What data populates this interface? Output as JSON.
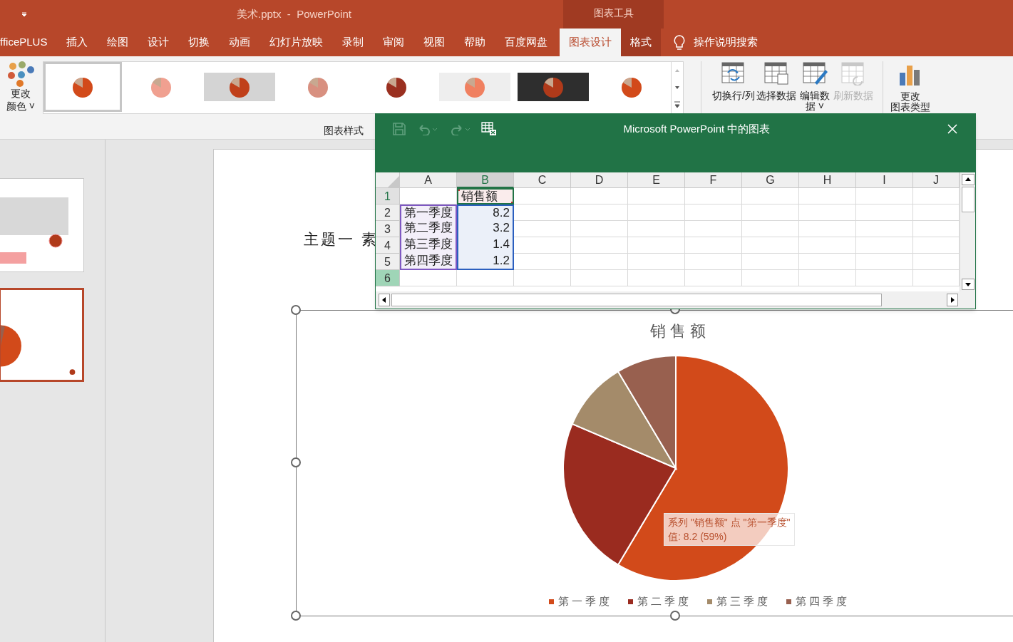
{
  "title_bar": {
    "title": "美术.pptx  -  PowerPoint",
    "context_group": "图表工具"
  },
  "tabs": [
    {
      "label": "fficePLUS",
      "selected": false,
      "context": false
    },
    {
      "label": "插入",
      "selected": false,
      "context": false
    },
    {
      "label": "绘图",
      "selected": false,
      "context": false
    },
    {
      "label": "设计",
      "selected": false,
      "context": false
    },
    {
      "label": "切换",
      "selected": false,
      "context": false
    },
    {
      "label": "动画",
      "selected": false,
      "context": false
    },
    {
      "label": "幻灯片放映",
      "selected": false,
      "context": false
    },
    {
      "label": "录制",
      "selected": false,
      "context": false
    },
    {
      "label": "审阅",
      "selected": false,
      "context": false
    },
    {
      "label": "视图",
      "selected": false,
      "context": false
    },
    {
      "label": "帮助",
      "selected": false,
      "context": false
    },
    {
      "label": "百度网盘",
      "selected": false,
      "context": false
    },
    {
      "label": "图表设计",
      "selected": true,
      "context": true
    },
    {
      "label": "格式",
      "selected": false,
      "context": true
    }
  ],
  "tell_me": "操作说明搜索",
  "ribbon": {
    "change_colors": {
      "line1": "更改",
      "line2": "颜色",
      "caret": "˅"
    },
    "gallery": {
      "label": "图表样式",
      "styles": [
        {
          "selected": true,
          "kind": "plain"
        },
        {
          "selected": false,
          "kind": "striped"
        },
        {
          "selected": false,
          "kind": "gray"
        },
        {
          "selected": false,
          "kind": "pale"
        },
        {
          "selected": false,
          "kind": "textured"
        },
        {
          "selected": false,
          "kind": "hatched"
        },
        {
          "selected": false,
          "kind": "dark"
        },
        {
          "selected": false,
          "kind": "plain"
        }
      ]
    },
    "data_buttons": [
      {
        "label": "切换行/列",
        "disabled": false
      },
      {
        "label": "选择数据",
        "disabled": false
      },
      {
        "label": "编辑数据",
        "disabled": false,
        "caret": "˅"
      },
      {
        "label": "刷新数据",
        "disabled": true
      }
    ],
    "chart_type_button": {
      "line1": "更改",
      "line2": "图表类型"
    }
  },
  "slides": [
    {
      "selected": false
    },
    {
      "selected": true
    }
  ],
  "slide": {
    "title": "主题一 素",
    "chart": {
      "tooltip": {
        "line1": "系列 \"销售额\" 点 \"第一季度\"",
        "line2": "值: 8.2 (59%)"
      },
      "chart_data": {
        "type": "pie",
        "title": "销售额",
        "legend": "bottom",
        "categories": [
          "第一季度",
          "第二季度",
          "第三季度",
          "第四季度"
        ],
        "series": [
          {
            "colors": [
              "#d24a1a",
              "#9a2b1f",
              "#a48b6a",
              "#98604f"
            ],
            "values": [
              58.57,
              22.86,
              10,
              8.57
            ]
          }
        ]
      }
    }
  },
  "sheet_window": {
    "title": "Microsoft PowerPoint 中的图表",
    "columns": [
      {
        "label": "A",
        "selected": false
      },
      {
        "label": "B",
        "selected": true
      },
      {
        "label": "C",
        "selected": false
      },
      {
        "label": "D",
        "selected": false
      },
      {
        "label": "E",
        "selected": false
      },
      {
        "label": "F",
        "selected": false
      },
      {
        "label": "G",
        "selected": false
      },
      {
        "label": "H",
        "selected": false
      },
      {
        "label": "I",
        "selected": false
      },
      {
        "label": "J",
        "selected": false
      }
    ],
    "rows": [
      {
        "label": "1",
        "selected": true,
        "filled": false,
        "column_b": {
          "text": "销售额",
          "color": "#c83232",
          "active": true
        }
      },
      {
        "label": "2",
        "selected": false,
        "filled": false,
        "column_a": {
          "text": "第一季度",
          "color": "#7e57c2",
          "active": false
        },
        "column_b": {
          "text": "8.2",
          "color": "#2b5fbf",
          "active": false
        }
      },
      {
        "label": "3",
        "selected": false,
        "filled": false,
        "column_a": {
          "text": "第二季度",
          "color": "#7e57c2",
          "active": false
        },
        "column_b": {
          "text": "3.2",
          "color": "#2b5fbf",
          "active": false
        }
      },
      {
        "label": "4",
        "selected": false,
        "filled": false,
        "column_a": {
          "text": "第三季度",
          "color": "#7e57c2",
          "active": false
        },
        "column_b": {
          "text": "1.4",
          "color": "#2b5fbf",
          "active": false
        }
      },
      {
        "label": "5",
        "selected": false,
        "filled": false,
        "column_a": {
          "text": "第四季度",
          "color": "#7e57c2",
          "active": false
        },
        "column_b": {
          "text": "1.2",
          "color": "#2b5fbf",
          "active": false
        }
      },
      {
        "label": "6",
        "selected": false,
        "filled": true
      }
    ]
  }
}
